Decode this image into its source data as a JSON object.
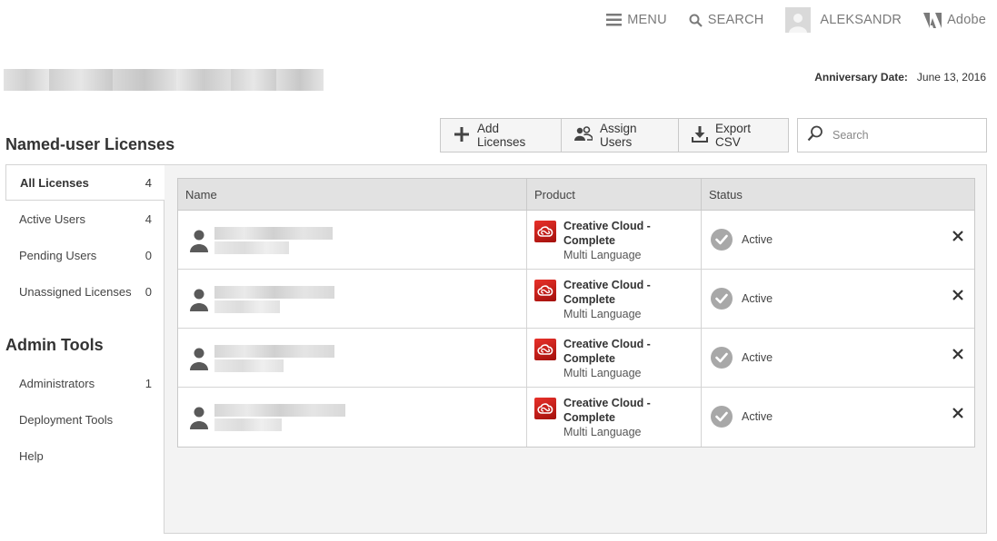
{
  "topnav": {
    "menu_label": "MENU",
    "search_label": "SEARCH",
    "user_label": "ALEKSANDR",
    "brand_label": "Adobe"
  },
  "header": {
    "anniversary_label": "Anniversary Date:",
    "anniversary_value": "June 13, 2016"
  },
  "toolbar": {
    "add_licenses": "Add Licenses",
    "assign_users": "Assign Users",
    "export_csv": "Export CSV",
    "search_placeholder": "Search"
  },
  "sidebar": {
    "licenses_title": "Named-user Licenses",
    "license_items": [
      {
        "label": "All Licenses",
        "count": "4",
        "active": true
      },
      {
        "label": "Active Users",
        "count": "4"
      },
      {
        "label": "Pending Users",
        "count": "0"
      },
      {
        "label": "Unassigned Licenses",
        "count": "0"
      }
    ],
    "admin_title": "Admin Tools",
    "admin_items": [
      {
        "label": "Administrators",
        "count": "1"
      },
      {
        "label": "Deployment Tools",
        "count": ""
      },
      {
        "label": "Help",
        "count": ""
      }
    ]
  },
  "table": {
    "columns": [
      "Name",
      "Product",
      "Status"
    ],
    "rows": [
      {
        "product_name": "Creative Cloud - Complete",
        "product_sub": "Multi Language",
        "status": "Active"
      },
      {
        "product_name": "Creative Cloud - Complete",
        "product_sub": "Multi Language",
        "status": "Active"
      },
      {
        "product_name": "Creative Cloud - Complete",
        "product_sub": "Multi Language",
        "status": "Active"
      },
      {
        "product_name": "Creative Cloud - Complete",
        "product_sub": "Multi Language",
        "status": "Active"
      }
    ]
  },
  "colors": {
    "accent_red": "#d7261e",
    "status_gray": "#a8a8a8",
    "panel_bg": "#f3f3f3"
  },
  "icons": [
    "hamburger-icon",
    "search-icon",
    "avatar-icon",
    "adobe-logo-icon",
    "plus-icon",
    "users-icon",
    "download-icon",
    "user-icon",
    "creative-cloud-icon",
    "check-circle-icon",
    "close-icon"
  ]
}
